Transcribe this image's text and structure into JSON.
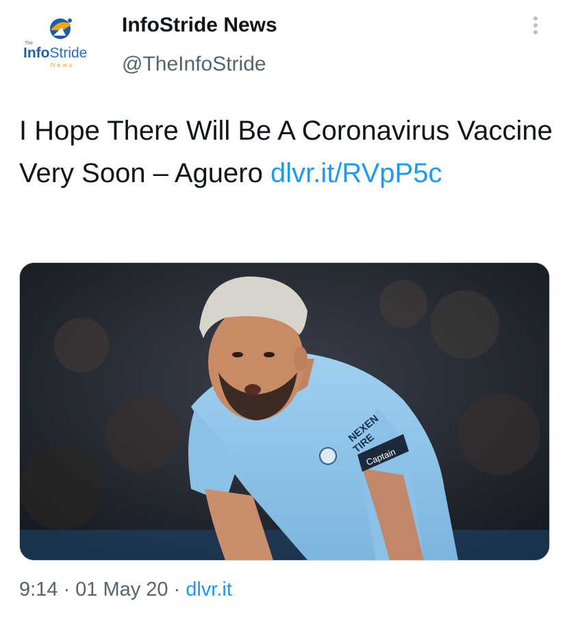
{
  "account": {
    "display_name": "InfoStride News",
    "handle": "@TheInfoStride",
    "avatar_logo": {
      "small": "The",
      "main_a": "Info",
      "main_b": "Stride",
      "sub": "News"
    }
  },
  "tweet": {
    "text": "I Hope There Will Be A Coronavirus Vaccine Very Soon – Aguero",
    "link": "dlvr.it/RVpP5c"
  },
  "media": {
    "jersey_text": [
      "NEXEN",
      "TIRE"
    ],
    "armband": "Captain"
  },
  "meta": {
    "time": "9:14",
    "date": "01 May 20",
    "source": "dlvr.it",
    "separator": "·"
  },
  "icons": [
    "more-options-icon",
    "logo-icon"
  ],
  "colors": {
    "link": "#1d9bf0",
    "text": "#0f1419",
    "muted": "#536471",
    "jersey": "#8ec3e8"
  }
}
